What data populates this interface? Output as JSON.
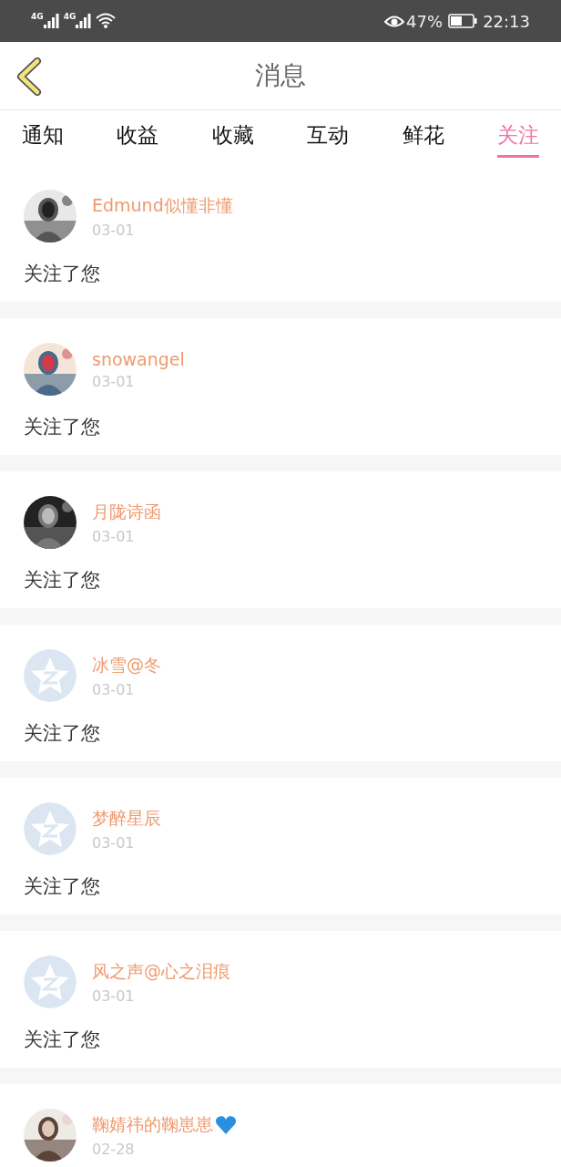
{
  "status_bar": {
    "network_1": "4G",
    "network_2": "4G",
    "battery": "47%",
    "time": "22:13"
  },
  "header": {
    "title": "消息"
  },
  "tabs": [
    {
      "label": "通知",
      "selected": false
    },
    {
      "label": "收益",
      "selected": false
    },
    {
      "label": "收藏",
      "selected": false
    },
    {
      "label": "互动",
      "selected": false
    },
    {
      "label": "鲜花",
      "selected": false
    },
    {
      "label": "关注",
      "selected": true
    }
  ],
  "messages": [
    {
      "name": "Edmund似懂非懂",
      "date": "03-01",
      "text": "关注了您"
    },
    {
      "name": "snowangel",
      "date": "03-01",
      "text": "关注了您"
    },
    {
      "name": "月陇诗函",
      "date": "03-01",
      "text": "关注了您"
    },
    {
      "kind": "default",
      "name": "冰雪@冬",
      "date": "03-01",
      "text": "关注了您"
    },
    {
      "kind": "default",
      "name": "梦醉星辰",
      "date": "03-01",
      "text": "关注了您"
    },
    {
      "kind": "default",
      "name": "风之声@心之泪痕",
      "date": "03-01",
      "text": "关注了您"
    },
    {
      "name": "鞠婧祎的鞠崽崽",
      "name_icon": {
        "kind": "heart"
      },
      "date": "02-28"
    }
  ]
}
